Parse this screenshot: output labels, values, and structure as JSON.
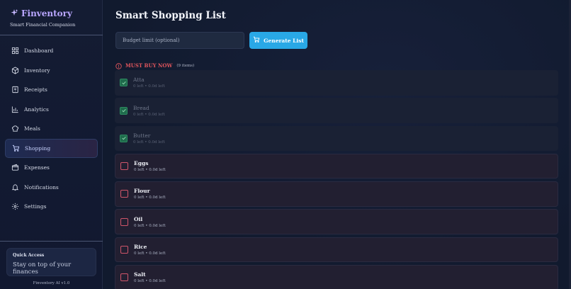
{
  "brand": {
    "title": "Finventory",
    "subtitle": "Smart Financial Companion"
  },
  "nav": [
    {
      "label": "Dashboard",
      "icon": "dashboard-icon"
    },
    {
      "label": "Inventory",
      "icon": "box-icon"
    },
    {
      "label": "Receipts",
      "icon": "receipt-icon"
    },
    {
      "label": "Analytics",
      "icon": "chart-icon"
    },
    {
      "label": "Meals",
      "icon": "chef-hat-icon"
    },
    {
      "label": "Shopping",
      "icon": "cart-icon",
      "active": true
    },
    {
      "label": "Expenses",
      "icon": "wallet-icon"
    },
    {
      "label": "Notifications",
      "icon": "bell-icon"
    },
    {
      "label": "Settings",
      "icon": "gear-icon"
    }
  ],
  "quick_access": {
    "title": "Quick Access",
    "text": "Stay on top of your finances"
  },
  "version": "Finventory AI v1.0",
  "main": {
    "title": "Smart Shopping List",
    "budget_placeholder": "Budget limit (optional)",
    "generate_label": "Generate List",
    "section": {
      "title": "MUST BUY NOW",
      "count": "(9 items)"
    }
  },
  "items": [
    {
      "name": "Atta",
      "meta": "0 left • 0.0d left",
      "checked": true
    },
    {
      "name": "Bread",
      "meta": "0 left • 0.0d left",
      "checked": true
    },
    {
      "name": "Butter",
      "meta": "0 left • 0.0d left",
      "checked": true
    },
    {
      "name": "Eggs",
      "meta": "0 left • 0.0d left",
      "checked": false
    },
    {
      "name": "Flour",
      "meta": "0 left • 0.0d left",
      "checked": false
    },
    {
      "name": "Oil",
      "meta": "0 left • 0.0d left",
      "checked": false
    },
    {
      "name": "Rice",
      "meta": "0 left • 0.0d left",
      "checked": false
    },
    {
      "name": "Salt",
      "meta": "0 left • 0.0d left",
      "checked": false
    }
  ],
  "colors": {
    "accent": "#29a8e6",
    "brand": "#b9a6ff",
    "alert": "#e0555c",
    "checked": "#1f6b4c"
  }
}
